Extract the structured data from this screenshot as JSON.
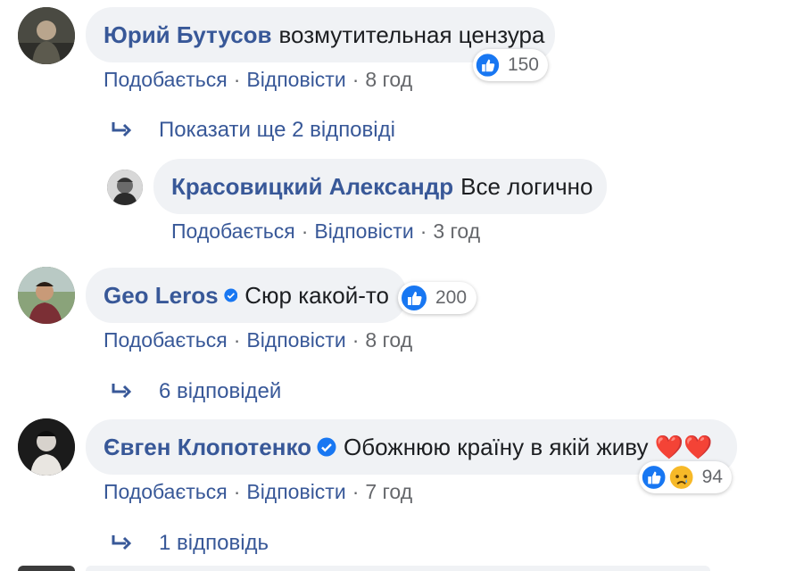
{
  "colors": {
    "link": "#385898",
    "bubble": "#f0f2f5",
    "like": "#1877f2",
    "muted": "#65676b"
  },
  "comments": [
    {
      "author": "Юрий Бутусов",
      "text": "возмутительная цензура",
      "verified": false,
      "reactions": {
        "icons": [
          "like-icon"
        ],
        "count": "150"
      },
      "actions": {
        "like": "Подобається",
        "reply": "Відповісти",
        "time": "8 год"
      },
      "replies_link": "Показати ще 2 відповіді"
    },
    {
      "author": "Geo Leros",
      "text": "Сюр какой-то",
      "verified": true,
      "reactions": {
        "icons": [
          "like-icon"
        ],
        "count": "200"
      },
      "actions": {
        "like": "Подобається",
        "reply": "Відповісти",
        "time": "8 год"
      },
      "replies_link": "6 відповідей"
    },
    {
      "author": "Євген Клопотенко",
      "text": "Обожнюю країну в якій живу ❤️❤️",
      "verified": true,
      "reactions": {
        "icons": [
          "like-icon",
          "sad-icon"
        ],
        "count": "94"
      },
      "actions": {
        "like": "Подобається",
        "reply": "Відповісти",
        "time": "7 год"
      },
      "replies_link": "1 відповідь"
    }
  ],
  "reply": {
    "author": "Красовицкий Александр",
    "text": "Все логично",
    "actions": {
      "like": "Подобається",
      "reply": "Відповісти",
      "time": "3 год"
    }
  },
  "separator": "·"
}
